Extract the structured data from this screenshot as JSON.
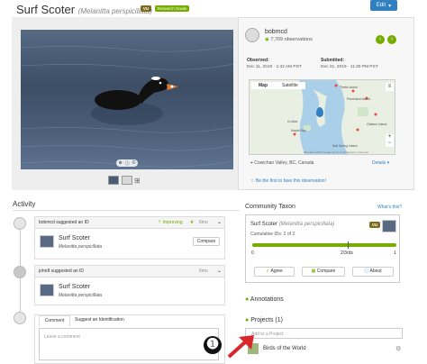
{
  "header": {
    "common_name": "Surf Scoter",
    "scientific_name": "(Melanitta perspicillata)",
    "status_badge": "VU",
    "grade_badge": "Research Grade",
    "edit_label": "Edit",
    "colors": {
      "accent": "#74ac00",
      "edit": "#2f7fc1",
      "vu": "#7d6b1d"
    }
  },
  "observer": {
    "username": "bobmcd",
    "observations": "7,769 observations",
    "observed_label": "Observed:",
    "observed_value": "Dec 11, 2019 · 1:42 AM PST",
    "submitted_label": "Submitted:",
    "submitted_value": "Dec 21, 2019 · 11:30 PM PST"
  },
  "map": {
    "tab_map": "Map",
    "tab_satellite": "Satellite",
    "place_labels": [
      "Thetis Island",
      "Penelakut Island",
      "Crofton",
      "Maple Bay",
      "Galiano Island",
      "Salt Spring Island"
    ],
    "footer": "Map data ©2020 Google   Terms of Use   Report a map error",
    "location": "Cowichan Valley, BC, Canada",
    "details": "Details ▾"
  },
  "fave": "Be the first to fave this observation!",
  "activity": {
    "heading": "Activity",
    "items": [
      {
        "user": "bobmcd",
        "action": "suggested an ID",
        "status": "Improving",
        "time": "6mo",
        "taxon": "Surf Scoter",
        "sci": "Melanitta perspicillata",
        "button": "Compare"
      },
      {
        "user": "john8",
        "action": "suggested an ID",
        "time": "6mo",
        "taxon": "Surf Scoter",
        "sci": "Melanitta perspicillata"
      }
    ],
    "tab_comment": "Comment",
    "tab_suggest": "Suggest an Identification",
    "placeholder": "Leave a comment"
  },
  "community": {
    "heading": "Community Taxon",
    "whats_this": "What's this?",
    "taxon": "Surf Scoter",
    "sci": "(Melanitta perspicillata)",
    "badge": "VU",
    "cumulative": "Cumulative IDs: 2 of 2",
    "scale_left": "0",
    "scale_mid": "2/3rds",
    "scale_right": "1",
    "progress_fraction": 1.0,
    "agree": "Agree",
    "compare": "Compare",
    "about": "About"
  },
  "annotations": "Annotations",
  "projects": {
    "heading": "Projects (1)",
    "placeholder": "Add to a Project",
    "project_name": "Birds of the World"
  },
  "marker_label": "❶"
}
